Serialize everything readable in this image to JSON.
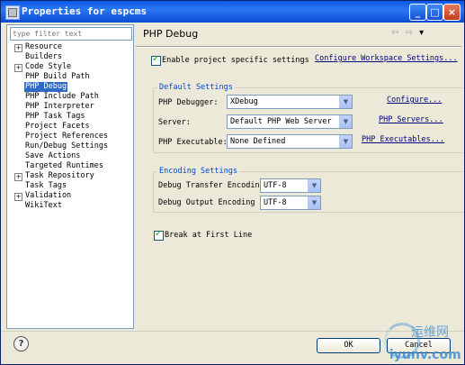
{
  "window": {
    "title": "Properties for espcms"
  },
  "title_buttons": {
    "minimize": "_",
    "maximize": "□",
    "close": "×"
  },
  "filter": {
    "placeholder": "type filter text"
  },
  "tree": [
    {
      "label": "Resource",
      "expandable": true
    },
    {
      "label": "Builders",
      "expandable": false
    },
    {
      "label": "Code Style",
      "expandable": true
    },
    {
      "label": "PHP Build Path",
      "expandable": false
    },
    {
      "label": "PHP Debug",
      "expandable": false,
      "selected": true
    },
    {
      "label": "PHP Include Path",
      "expandable": false
    },
    {
      "label": "PHP Interpreter",
      "expandable": false
    },
    {
      "label": "PHP Task Tags",
      "expandable": false
    },
    {
      "label": "Project Facets",
      "expandable": false
    },
    {
      "label": "Project References",
      "expandable": false
    },
    {
      "label": "Run/Debug Settings",
      "expandable": false
    },
    {
      "label": "Save Actions",
      "expandable": false
    },
    {
      "label": "Targeted Runtimes",
      "expandable": false
    },
    {
      "label": "Task Repository",
      "expandable": true
    },
    {
      "label": "Task Tags",
      "expandable": false
    },
    {
      "label": "Validation",
      "expandable": true
    },
    {
      "label": "WikiText",
      "expandable": false
    }
  ],
  "page": {
    "title": "PHP Debug",
    "nav": {
      "back": "⇦",
      "forward": "⇨",
      "menu": "▾"
    },
    "enable_specific": {
      "label": "Enable project specific settings",
      "checked": true
    },
    "configure_workspace_link": "Configure Workspace Settings...",
    "default_settings": {
      "title": "Default Settings",
      "debugger_label": "PHP Debugger:",
      "debugger_value": "XDebug",
      "configure_link": "Configure...",
      "server_label": "Server:",
      "server_value": "Default PHP Web Server",
      "servers_link": "PHP Servers...",
      "executable_label": "PHP Executable:",
      "executable_value": "None Defined",
      "executables_link": "PHP Executables..."
    },
    "encoding_settings": {
      "title": "Encoding Settings",
      "transfer_label": "Debug Transfer Encoding",
      "transfer_value": "UTF-8",
      "output_label": "Debug Output Encoding",
      "output_value": "UTF-8"
    },
    "break_first_line": {
      "label": "Break at First Line",
      "checked": true
    }
  },
  "footer": {
    "help": "?",
    "ok_label": "OK",
    "cancel_label": "Cancel"
  },
  "watermark": {
    "line1": "运维网",
    "line2": "iyunv.com"
  },
  "colors": {
    "title_bar": "#0a5ae8",
    "selection": "#316ac5",
    "group_title": "#0046d5",
    "link": "#000080"
  }
}
